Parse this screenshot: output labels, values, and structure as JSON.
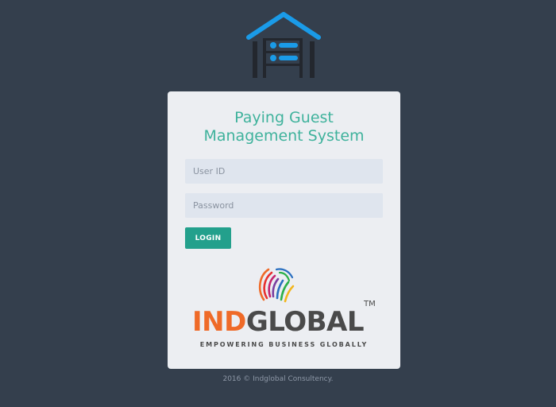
{
  "app": {
    "logo_icon": "house-list-icon",
    "title_line1": "Paying Guest",
    "title_line2": "Management System",
    "accent_color": "#3fb29c"
  },
  "form": {
    "userid_placeholder": "User ID",
    "password_placeholder": "Password",
    "login_label": "LOGIN",
    "button_color": "#23a08c"
  },
  "brand": {
    "mark_icon": "indglobal-arc-logo-icon",
    "name_part1": "IND",
    "name_part2": "GLOBAL",
    "trademark": "TM",
    "tagline": "EMPOWERING BUSINESS GLOBALLY"
  },
  "footer": {
    "text": "2016 © Indglobal Consultency."
  }
}
